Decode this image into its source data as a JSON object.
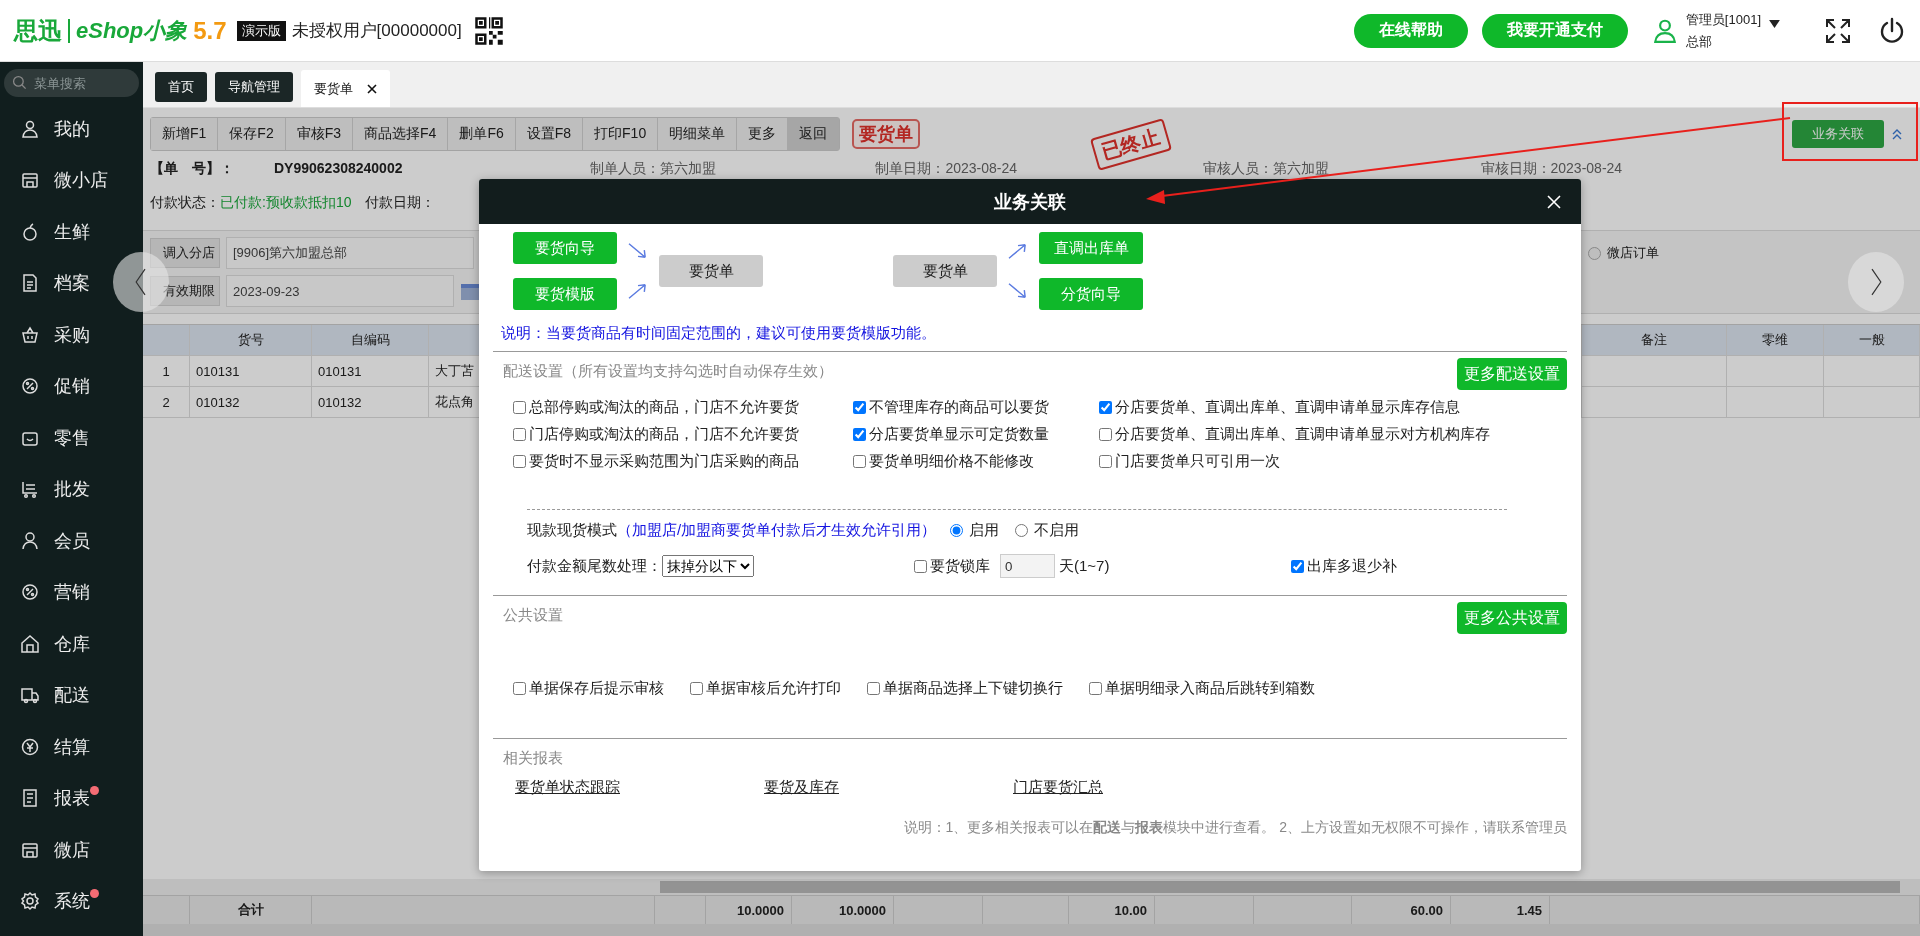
{
  "header": {
    "logo_mark": "思迅",
    "brand": "eShop小象",
    "version": "5.7",
    "edition": "演示版",
    "license": "未授权用户[00000000]",
    "buttons": [
      "在线帮助",
      "我要开通支付"
    ],
    "user": {
      "name": "管理员[1001]",
      "dept": "总部"
    }
  },
  "sidebar": {
    "search": {
      "placeholder": "菜单搜索"
    },
    "items": [
      {
        "label": "我的",
        "notification": false
      },
      {
        "label": "微小店",
        "notification": false
      },
      {
        "label": "生鲜",
        "notification": false
      },
      {
        "label": "档案",
        "notification": false
      },
      {
        "label": "采购",
        "notification": false
      },
      {
        "label": "促销",
        "notification": false
      },
      {
        "label": "零售",
        "notification": false
      },
      {
        "label": "批发",
        "notification": false
      },
      {
        "label": "会员",
        "notification": false
      },
      {
        "label": "营销",
        "notification": false
      },
      {
        "label": "仓库",
        "notification": false
      },
      {
        "label": "配送",
        "notification": false
      },
      {
        "label": "结算",
        "notification": false
      },
      {
        "label": "报表",
        "notification": true
      },
      {
        "label": "微店",
        "notification": false
      },
      {
        "label": "系统",
        "notification": true
      }
    ]
  },
  "tabs": [
    {
      "label": "首页",
      "selected": false,
      "closable": false
    },
    {
      "label": "导航管理",
      "selected": false,
      "closable": false
    },
    {
      "label": "要货单",
      "selected": true,
      "closable": true
    }
  ],
  "toolbar": {
    "buttons": [
      {
        "label": "新增F1",
        "selected": false
      },
      {
        "label": "保存F2",
        "selected": false
      },
      {
        "label": "审核F3",
        "selected": false
      },
      {
        "label": "商品选择F4",
        "selected": false
      },
      {
        "label": "删单F6",
        "selected": false
      },
      {
        "label": "设置F8",
        "selected": false
      },
      {
        "label": "打印F10",
        "selected": false
      },
      {
        "label": "明细菜单",
        "selected": false
      },
      {
        "label": "更多",
        "selected": false
      },
      {
        "label": "返回",
        "selected": true
      }
    ],
    "doc_title": "要货单",
    "stamp": "已终止",
    "link_button": "业务关联"
  },
  "document": {
    "rows": [
      [
        {
          "label": "【单　号】：",
          "value": "DY99062308240002",
          "highlight": false
        },
        {
          "label": "制单人员：",
          "value": "第六加盟",
          "highlight": false
        },
        {
          "label": "制单日期：",
          "value": "2023-08-24",
          "highlight": false
        },
        {
          "label": "审核人员：",
          "value": "第六加盟",
          "highlight": false
        },
        {
          "label": "审核日期：",
          "value": "2023-08-24",
          "highlight": false
        }
      ],
      [
        {
          "label": "付款状态：",
          "value": "已付款:预收款抵扣10",
          "highlight": true
        },
        {
          "label": "付款日期："
        }
      ]
    ],
    "store": {
      "label": "调入分店",
      "value": "[9906]第六加盟总部"
    },
    "expiry": {
      "label": "有效期限",
      "value": "2023-09-23"
    },
    "wechat_order": {
      "label": "微店订单",
      "selected": false
    }
  },
  "table": {
    "columns": [
      "货号",
      "自编码",
      "备注",
      "零维",
      "一般"
    ],
    "rows": [
      {
        "index": "1",
        "code": "010131",
        "own_code": "010131",
        "name": "大丁苫"
      },
      {
        "index": "2",
        "code": "010132",
        "own_code": "010132",
        "name": "花点角"
      }
    ],
    "totals": {
      "label": "合计",
      "values": [
        "10.0000",
        "10.0000",
        "10.00",
        "60.00",
        "1.45"
      ]
    }
  },
  "dialog": {
    "title": "业务关联",
    "flow_left": {
      "sources": [
        "要货向导",
        "要货模版"
      ],
      "target": "要货单"
    },
    "flow_right": {
      "source": "要货单",
      "targets": [
        "直调出库单",
        "分货向导"
      ]
    },
    "note": "说明：当要货商品有时间固定范围的，建议可使用要货模版功能。",
    "delivery": {
      "title": "配送设置（所有设置均支持勾选时自动保存生效）",
      "more_button": "更多配送设置",
      "options": [
        {
          "label": "总部停购或淘汰的商品，门店不允许要货",
          "checked": false
        },
        {
          "label": "不管理库存的商品可以要货",
          "checked": true
        },
        {
          "label": "分店要货单、直调出库单、直调申请单显示库存信息",
          "checked": true
        },
        {
          "label": "门店停购或淘汰的商品，门店不允许要货",
          "checked": false
        },
        {
          "label": "分店要货单显示可定货数量",
          "checked": true
        },
        {
          "label": "分店要货单、直调出库单、直调申请单显示对方机构库存",
          "checked": false
        },
        {
          "label": "要货时不显示采购范围为门店采购的商品",
          "checked": false
        },
        {
          "label": "要货单明细价格不能修改",
          "checked": false
        },
        {
          "label": "门店要货单只可引用一次",
          "checked": false
        }
      ],
      "cash_mode": {
        "label": "现款现货模式",
        "hint": "（加盟店/加盟商要货单付款后才生效允许引用）",
        "choices": [
          {
            "label": "启用",
            "selected": true
          },
          {
            "label": "不启用",
            "selected": false
          }
        ]
      },
      "rounding": {
        "label": "付款金额尾数处理：",
        "value": "抹掉分以下"
      },
      "stock_lock": {
        "label": "要货锁库",
        "checked": false,
        "value": "0",
        "unit": "天(1~7)"
      },
      "refund": {
        "label": "出库多退少补",
        "checked": true
      }
    },
    "public": {
      "title": "公共设置",
      "more_button": "更多公共设置",
      "options": [
        {
          "label": "单据保存后提示审核",
          "checked": false
        },
        {
          "label": "单据审核后允许打印",
          "checked": false
        },
        {
          "label": "单据商品选择上下键切换行",
          "checked": false
        },
        {
          "label": "单据明细录入商品后跳转到箱数",
          "checked": false
        }
      ]
    },
    "reports": {
      "title": "相关报表",
      "links": [
        "要货单状态跟踪",
        "要货及库存",
        "门店要货汇总"
      ],
      "footnote": "说明：1、更多相关报表可以在**配送**与**报表**模块中进行查看。 2、上方设置如无权限不可操作，请联系管理员"
    }
  }
}
